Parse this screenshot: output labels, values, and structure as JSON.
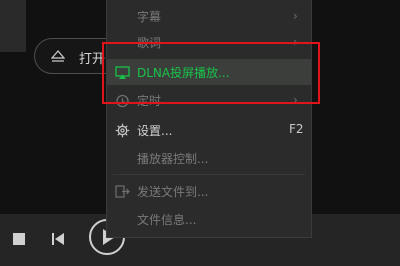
{
  "main": {
    "open_label": "打开"
  },
  "menu": {
    "items": [
      {
        "label": "字幕",
        "enabled": false,
        "has_submenu": true,
        "icon": "none"
      },
      {
        "label": "歌词",
        "enabled": false,
        "has_submenu": true,
        "icon": "none"
      },
      {
        "label": "DLNA投屏播放...",
        "enabled": true,
        "highlighted": true,
        "icon": "cast-screen-icon"
      },
      {
        "label": "定时",
        "enabled": false,
        "has_submenu": true,
        "icon": "timer-icon"
      },
      {
        "label": "设置...",
        "enabled": true,
        "shortcut": "F2",
        "icon": "gear-icon"
      },
      {
        "label": "播放器控制...",
        "enabled": false,
        "icon": "none"
      },
      {
        "label": "发送文件到...",
        "enabled": false,
        "icon": "send-file-icon"
      },
      {
        "label": "文件信息...",
        "enabled": false,
        "icon": "none"
      }
    ],
    "submenu_arrow": "›"
  },
  "colors": {
    "highlight_text": "#19c34a",
    "annotation_box": "#e0151c"
  }
}
